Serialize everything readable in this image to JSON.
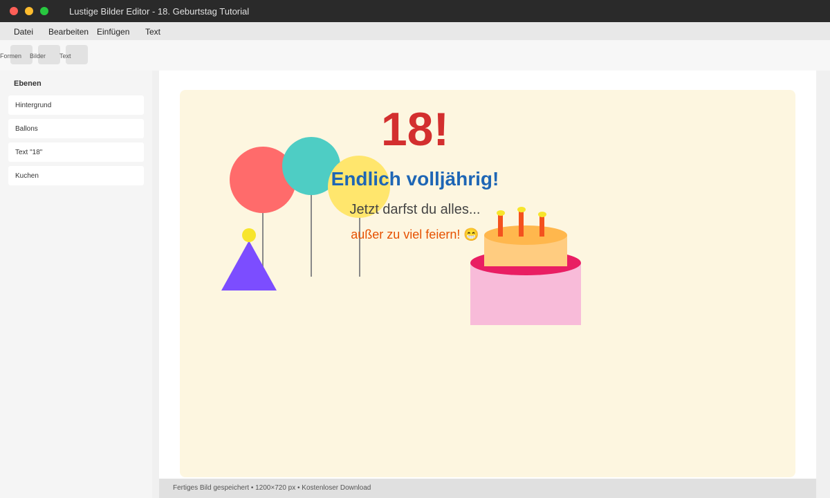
{
  "window": {
    "title": "Lustige Bilder Editor - 18. Geburtstag Tutorial"
  },
  "menu": {
    "file": "Datei",
    "edit": "Bearbeiten",
    "insert": "Einfügen",
    "text": "Text"
  },
  "toolbar": {
    "shapes": "Formen",
    "images": "Bilder",
    "text": "Text"
  },
  "layers": {
    "title": "Ebenen",
    "items": [
      {
        "label": "Hintergrund"
      },
      {
        "label": "Ballons"
      },
      {
        "label": "Text \"18\""
      },
      {
        "label": "Kuchen"
      }
    ]
  },
  "artwork": {
    "big_number": "18!",
    "headline": "Endlich volljährig!",
    "subline": "Jetzt darfst du alles...",
    "joke": "außer zu viel feiern! 😁",
    "colors": {
      "background": "#fdf6e0",
      "balloon_red": "#ff6b6b",
      "balloon_teal": "#4ecdc4",
      "balloon_yellow": "#ffe66d",
      "party_hat": "#7c4dff",
      "cake_body": "#f8bbd9",
      "cake_plate": "#e91e63",
      "cake_top": "#ffcc80",
      "candles": "#f4511e"
    }
  },
  "status": {
    "text": "Fertiges Bild gespeichert • 1200×720 px • Kostenloser Download"
  }
}
